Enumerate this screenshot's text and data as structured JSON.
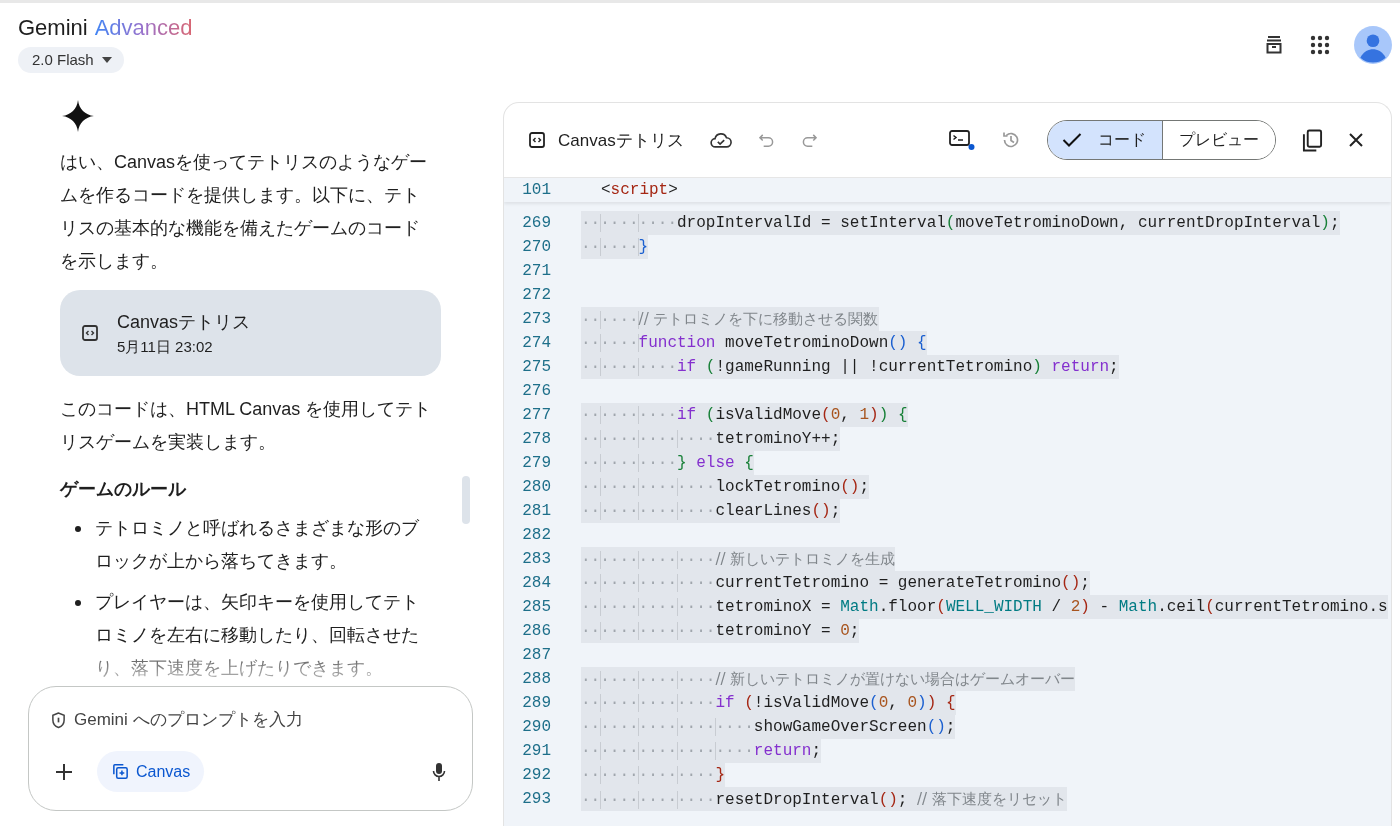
{
  "header": {
    "app_name": "Gemini",
    "plan": "Advanced",
    "model": "2.0 Flash"
  },
  "response": [
    {
      "kind": "paragraph",
      "text": "はい、Canvasを使ってテトリスのようなゲームを作るコードを提供します。以下に、テトリスの基本的な機能を備えたゲームのコードを示します。"
    },
    {
      "kind": "artifact",
      "title": "Canvasテトリス",
      "date": "5月11日 23:02"
    },
    {
      "kind": "paragraph",
      "text": "このコードは、HTML Canvas を使用してテトリスゲームを実装します。"
    },
    {
      "kind": "heading",
      "text": "ゲームのルール"
    },
    {
      "kind": "bullets",
      "items": [
        "テトロミノと呼ばれるさまざまな形のブロックが上から落ちてきます。",
        "プレイヤーは、矢印キーを使用してテトロミノを左右に移動したり、回転させたり、落下速度を上げたりできます。"
      ]
    }
  ],
  "prompt": {
    "placeholder": "Gemini へのプロンプトを入力",
    "tool": "Canvas"
  },
  "canvas": {
    "title": "Canvasテトリス",
    "view_toggle": [
      {
        "label": "コード",
        "selected": true
      },
      {
        "label": "プレビュー",
        "selected": false
      }
    ],
    "sticky_line": {
      "num": "101",
      "tokens": [
        {
          "text": "<",
          "kind": "plain"
        },
        {
          "text": "script",
          "kind": "tag"
        },
        {
          "text": ">",
          "kind": "plain"
        }
      ]
    },
    "lines": [
      {
        "num": "269",
        "tokens": [
          {
            "text": "··········",
            "kind": "indent"
          },
          {
            "text": "dropIntervalId = setInterval",
            "kind": "plain"
          },
          {
            "text": "(",
            "kind": "green"
          },
          {
            "text": "moveTetrominoDown, currentDropInterval",
            "kind": "plain"
          },
          {
            "text": ")",
            "kind": "green"
          },
          {
            "text": ";",
            "kind": "plain"
          }
        ]
      },
      {
        "num": "270",
        "tokens": [
          {
            "text": "······",
            "kind": "indent"
          },
          {
            "text": "}",
            "kind": "blue"
          }
        ]
      },
      {
        "num": "271"
      },
      {
        "num": "272"
      },
      {
        "num": "273",
        "tokens": [
          {
            "text": "······",
            "kind": "indent"
          },
          {
            "text": "// テトロミノを下に移動させる関数",
            "kind": "comment"
          }
        ]
      },
      {
        "num": "274",
        "tokens": [
          {
            "text": "······",
            "kind": "indent"
          },
          {
            "text": "function",
            "kind": "keyword"
          },
          {
            "text": " moveTetrominoDown",
            "kind": "plain"
          },
          {
            "text": "()",
            "kind": "blue"
          },
          {
            "text": " {",
            "kind": "blue"
          }
        ]
      },
      {
        "num": "275",
        "tokens": [
          {
            "text": "··········",
            "kind": "indent"
          },
          {
            "text": "if",
            "kind": "keyword"
          },
          {
            "text": " (",
            "kind": "green"
          },
          {
            "text": "!gameRunning || !currentTetromino",
            "kind": "plain"
          },
          {
            "text": ")",
            "kind": "green"
          },
          {
            "text": " return",
            "kind": "keyword"
          },
          {
            "text": ";",
            "kind": "plain"
          }
        ]
      },
      {
        "num": "276"
      },
      {
        "num": "277",
        "tokens": [
          {
            "text": "··········",
            "kind": "indent"
          },
          {
            "text": "if",
            "kind": "keyword"
          },
          {
            "text": " (",
            "kind": "green"
          },
          {
            "text": "isValidMove",
            "kind": "plain"
          },
          {
            "text": "(",
            "kind": "brown"
          },
          {
            "text": "0",
            "kind": "number"
          },
          {
            "text": ", ",
            "kind": "plain"
          },
          {
            "text": "1",
            "kind": "number"
          },
          {
            "text": ")",
            "kind": "brown"
          },
          {
            "text": ")",
            "kind": "green"
          },
          {
            "text": " {",
            "kind": "green"
          }
        ]
      },
      {
        "num": "278",
        "tokens": [
          {
            "text": "··············",
            "kind": "indent"
          },
          {
            "text": "tetrominoY++;",
            "kind": "plain"
          }
        ]
      },
      {
        "num": "279",
        "tokens": [
          {
            "text": "··········",
            "kind": "indent"
          },
          {
            "text": "}",
            "kind": "green"
          },
          {
            "text": " else",
            "kind": "keyword"
          },
          {
            "text": " {",
            "kind": "green"
          }
        ]
      },
      {
        "num": "280",
        "tokens": [
          {
            "text": "··············",
            "kind": "indent"
          },
          {
            "text": "lockTetromino",
            "kind": "plain"
          },
          {
            "text": "()",
            "kind": "brown"
          },
          {
            "text": ";",
            "kind": "plain"
          }
        ]
      },
      {
        "num": "281",
        "tokens": [
          {
            "text": "··············",
            "kind": "indent"
          },
          {
            "text": "clearLines",
            "kind": "plain"
          },
          {
            "text": "()",
            "kind": "brown"
          },
          {
            "text": ";",
            "kind": "plain"
          }
        ]
      },
      {
        "num": "282"
      },
      {
        "num": "283",
        "tokens": [
          {
            "text": "··············",
            "kind": "indent"
          },
          {
            "text": "// 新しいテトロミノを生成",
            "kind": "comment"
          }
        ]
      },
      {
        "num": "284",
        "tokens": [
          {
            "text": "··············",
            "kind": "indent"
          },
          {
            "text": "currentTetromino = generateTetromino",
            "kind": "plain"
          },
          {
            "text": "()",
            "kind": "brown"
          },
          {
            "text": ";",
            "kind": "plain"
          }
        ]
      },
      {
        "num": "285",
        "tokens": [
          {
            "text": "··············",
            "kind": "indent"
          },
          {
            "text": "tetrominoX = ",
            "kind": "plain"
          },
          {
            "text": "Math",
            "kind": "builtin"
          },
          {
            "text": ".floor",
            "kind": "plain"
          },
          {
            "text": "(",
            "kind": "brown"
          },
          {
            "text": "WELL_WIDTH",
            "kind": "builtin"
          },
          {
            "text": " / ",
            "kind": "plain"
          },
          {
            "text": "2",
            "kind": "number"
          },
          {
            "text": ")",
            "kind": "brown"
          },
          {
            "text": " - ",
            "kind": "plain"
          },
          {
            "text": "Math",
            "kind": "builtin"
          },
          {
            "text": ".ceil",
            "kind": "plain"
          },
          {
            "text": "(",
            "kind": "brown"
          },
          {
            "text": "currentTetromino.s",
            "kind": "plain"
          }
        ]
      },
      {
        "num": "286",
        "tokens": [
          {
            "text": "··············",
            "kind": "indent"
          },
          {
            "text": "tetrominoY = ",
            "kind": "plain"
          },
          {
            "text": "0",
            "kind": "number"
          },
          {
            "text": ";",
            "kind": "plain"
          }
        ]
      },
      {
        "num": "287"
      },
      {
        "num": "288",
        "tokens": [
          {
            "text": "··············",
            "kind": "indent"
          },
          {
            "text": "// 新しいテトロミノが置けない場合はゲームオーバー",
            "kind": "comment"
          }
        ]
      },
      {
        "num": "289",
        "tokens": [
          {
            "text": "··············",
            "kind": "indent"
          },
          {
            "text": "if",
            "kind": "keyword"
          },
          {
            "text": " (",
            "kind": "brown"
          },
          {
            "text": "!isValidMove",
            "kind": "plain"
          },
          {
            "text": "(",
            "kind": "blue"
          },
          {
            "text": "0",
            "kind": "number"
          },
          {
            "text": ", ",
            "kind": "plain"
          },
          {
            "text": "0",
            "kind": "number"
          },
          {
            "text": ")",
            "kind": "blue"
          },
          {
            "text": ")",
            "kind": "brown"
          },
          {
            "text": " {",
            "kind": "brown"
          }
        ]
      },
      {
        "num": "290",
        "tokens": [
          {
            "text": "··················",
            "kind": "indent"
          },
          {
            "text": "showGameOverScreen",
            "kind": "plain"
          },
          {
            "text": "()",
            "kind": "blue"
          },
          {
            "text": ";",
            "kind": "plain"
          }
        ]
      },
      {
        "num": "291",
        "tokens": [
          {
            "text": "··················",
            "kind": "indent"
          },
          {
            "text": "return",
            "kind": "keyword"
          },
          {
            "text": ";",
            "kind": "plain"
          }
        ]
      },
      {
        "num": "292",
        "tokens": [
          {
            "text": "··············",
            "kind": "indent"
          },
          {
            "text": "}",
            "kind": "brown"
          }
        ]
      },
      {
        "num": "293",
        "tokens": [
          {
            "text": "··············",
            "kind": "indent"
          },
          {
            "text": "resetDropInterval",
            "kind": "plain"
          },
          {
            "text": "()",
            "kind": "brown"
          },
          {
            "text": "; ",
            "kind": "plain"
          },
          {
            "text": "// 落下速度をリセット",
            "kind": "comment"
          }
        ]
      }
    ]
  }
}
